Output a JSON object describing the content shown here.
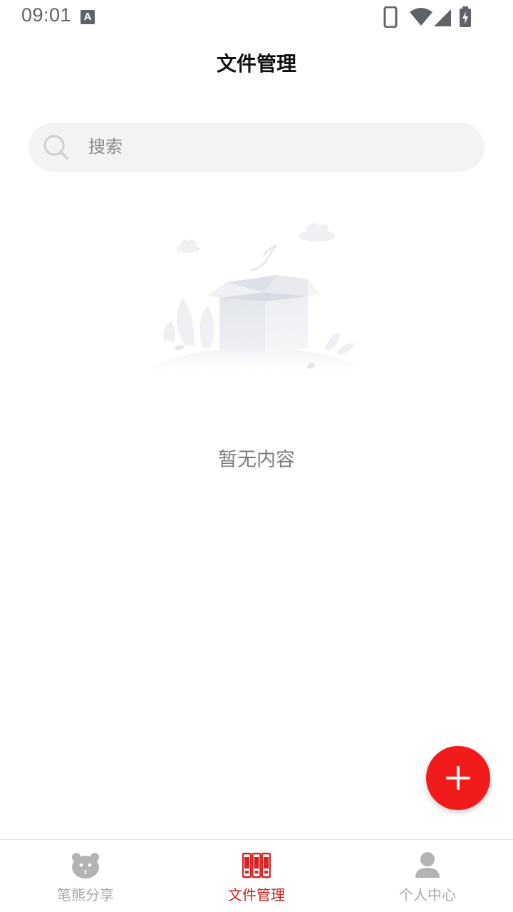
{
  "status_bar": {
    "time": "09:01",
    "a_icon_letter": "A",
    "icons": [
      "phone-icon",
      "wifi-icon",
      "signal-icon",
      "battery-charging-icon"
    ]
  },
  "header": {
    "title": "文件管理"
  },
  "search": {
    "placeholder": "搜索",
    "icon": "search-icon"
  },
  "empty_state": {
    "illustration": "empty-box-illustration",
    "text": "暂无内容"
  },
  "fab": {
    "icon": "plus-icon",
    "color": "#f21b1b"
  },
  "bottom_nav": {
    "items": [
      {
        "label": "笔熊分享",
        "icon": "bear-icon",
        "active": false
      },
      {
        "label": "文件管理",
        "icon": "files-icon",
        "active": true
      },
      {
        "label": "个人中心",
        "icon": "user-icon",
        "active": false
      }
    ],
    "active_color": "#c81f1f",
    "inactive_color": "#a8a8a8"
  }
}
